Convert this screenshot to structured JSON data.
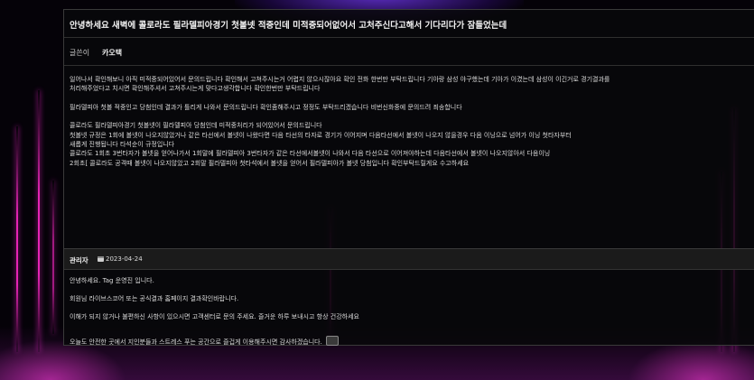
{
  "post": {
    "title": "안녕하세요 새벽에 콜로라도 필라델피아경기 첫볼넷 적중인데 미적중되어없어서 고처주신다고해서 기다리다가 잠들었는데",
    "author_label": "글쓴이",
    "author": "카오택",
    "body_lines": [
      "일어나서 확인해보니 아직 미적중되어있어서 문의드립니다 확인해서 고쳐주시는거 어렵지 않으시잖아요 확인 전화 한번만 부탁드립니다 기아랑 삼성 야구했는데 기아가 이겼는데 삼성이 이긴거로 경기결과를",
      "처리해주었다고 치시면 확인해주셔서 고쳐주시는게 맞다고생각합니다 확인한번만 부탁드립니다",
      "",
      "필라델피아 첫볼 적중인고 당첨인데 결과가 틀리게 나와서 문의드립니다 확인좀해주시고 정정도 부탁드리겠습니다 비번신화중에 문의드려 죄송합니다",
      "",
      "콜로라도 필라델피아경기 첫볼넷이 필라델피아 당첨인데 미적중처리가 되어있어서 문의드립니다",
      "첫볼넷 규정은 1회에 볼넷이 나오지않았거나 같은 타선에서 볼넷이 나왔다면 다음 타선의 타자로 경기가 이어지며 다음타선에서 볼넷이 나오지 않을경우 다음 이닝으로 넘어가 이닝 첫타자부터",
      "새롭게 진행됩니다 타석순이 규정입니다",
      "콜로라도 1회초 3번타자가 볼넷을 얻어나가서 1회말에 필라델피아 3번타자가 같은 타선에서볼넷이 나와서 다음 타선으로 이어져야하는데 다음타선에서 볼넷이 나오지않아서 다음이닝",
      "2회초[ 콜로라도 공격때 볼넷이 나오지않았고 2회말 필라델피아 첫타석에서 볼넷을 얻어서 필라델피아가 볼넷 당첨입니다 확인부탁드릴게요 수고하세요"
    ]
  },
  "comment": {
    "author": "관리자",
    "date": "2023-04-24",
    "lines": [
      "안녕하세요. Tag 운영진 입니다.",
      "회원님 라이브스코어 또는 공식결과 홈페이지 결과확인바랍니다.",
      "이해가 되지 않거나 불편하신 사항이 있으시면 고객센터로 문의 주세요. 즐거운 하루 보내시고 항상 건강하세요",
      "오늘도 안전한 곳에서 지인분들과 스트레스 푸는 공간으로 즐겁게 이용해주시면 감사하겠습니다."
    ]
  },
  "colors": {
    "neon_pink": "#ff28c8",
    "neon_purple": "#7a3cff",
    "panel": "#08080a"
  }
}
